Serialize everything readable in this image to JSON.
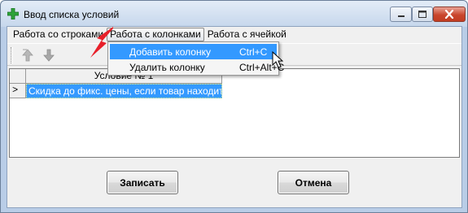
{
  "window": {
    "title": "Ввод списка условий",
    "min_icon": "minimize-icon",
    "max_icon": "maximize-icon",
    "close_icon": "close-icon"
  },
  "menubar": {
    "items": [
      {
        "label": "Работа со строками"
      },
      {
        "label": "Работа с колонками",
        "active": true
      },
      {
        "label": "Работа с ячейкой"
      }
    ]
  },
  "toolbar": {
    "buttons": [
      {
        "icon": "move-up-icon",
        "enabled": false
      },
      {
        "icon": "move-down-icon",
        "enabled": false
      }
    ]
  },
  "grid": {
    "column_header": "Условие № 1",
    "row_indicator": ">",
    "cell_value": "Скидка до фикс. цены, если товар находится"
  },
  "dropdown": {
    "items": [
      {
        "label": "Добавить колонку",
        "shortcut": "Ctrl+C",
        "highlighted": true
      },
      {
        "label": "Удалить колонку",
        "shortcut": "Ctrl+Alt+C",
        "highlighted": false
      }
    ]
  },
  "buttons": {
    "save_label": "Записать",
    "cancel_label": "Отмена"
  },
  "colors": {
    "selection": "#3399ff",
    "annotation_arrow": "#e8202a",
    "app_icon": "#2fa33a"
  }
}
